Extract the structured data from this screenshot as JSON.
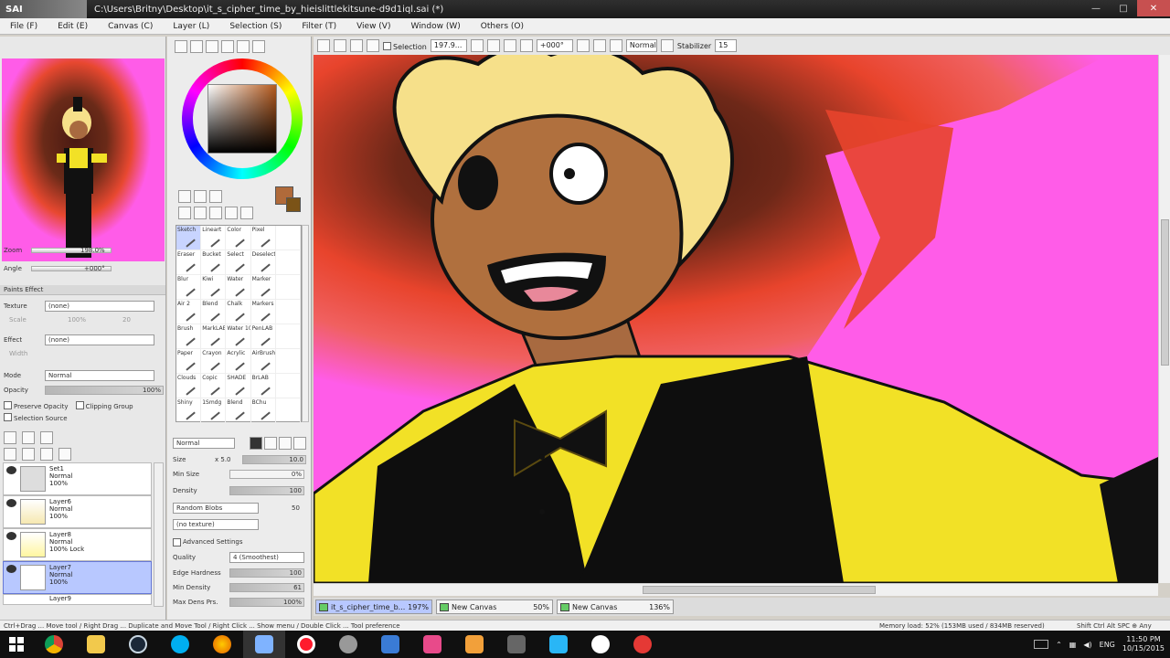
{
  "window": {
    "app_logo": "SAI",
    "title": "C:\\Users\\Britny\\Desktop\\it_s_cipher_time_by_hieislittlekitsune-d9d1iql.sai (*)",
    "min": "—",
    "max": "□",
    "close": "✕"
  },
  "menu": [
    "File (F)",
    "Edit (E)",
    "Canvas (C)",
    "Layer (L)",
    "Selection (S)",
    "Filter (T)",
    "View (V)",
    "Window (W)",
    "Others (O)"
  ],
  "options": {
    "selection_label": "Selection",
    "zoom_value": "197.9...",
    "rotation_value": "+000°",
    "mode_value": "Normal",
    "stabilizer_label": "Stabilizer",
    "stabilizer_value": "15"
  },
  "navigator": {
    "zoom_label": "Zoom",
    "zoom_value": "198.0%",
    "angle_label": "Angle",
    "angle_value": "+000°"
  },
  "paper_effect": {
    "header": "Paints Effect",
    "texture_label": "Texture",
    "texture_value": "(none)",
    "texture_scale_label": "Scale",
    "texture_scale_value": "100%",
    "texture_strength": "20",
    "effect_label": "Effect",
    "effect_value": "(none)",
    "effect_width_label": "Width"
  },
  "layer_props": {
    "mode_label": "Mode",
    "mode_value": "Normal",
    "opacity_label": "Opacity",
    "opacity_value": "100%",
    "preserve_opacity": "Preserve Opacity",
    "clipping_group": "Clipping Group",
    "selection_source": "Selection Source"
  },
  "layers": [
    {
      "name": "Set1",
      "mode": "Normal",
      "opacity": "100%",
      "active": false
    },
    {
      "name": "Layer6",
      "mode": "Normal",
      "opacity": "100%",
      "active": false
    },
    {
      "name": "Layer8",
      "mode": "Normal",
      "opacity": "100% Lock",
      "active": false
    },
    {
      "name": "Layer7",
      "mode": "Normal",
      "opacity": "100%",
      "active": true
    },
    {
      "name": "Layer9",
      "mode": "",
      "opacity": "",
      "active": false
    }
  ],
  "brushes": [
    "Sketch",
    "Lineart",
    "Color",
    "Pixel",
    "",
    "Eraser",
    "Bucket",
    "Select",
    "Deselect",
    "",
    "Blur",
    "Kiwi",
    "Water",
    "Marker",
    "",
    "Air 2",
    "Blend",
    "Chalk",
    "Markers",
    "",
    "Brush",
    "MarkLAB",
    "Water 10",
    "PenLAB",
    "",
    "Paper",
    "Crayon",
    "Acrylic",
    "AirBrush",
    "",
    "Clouds",
    "Copic",
    "SHADE",
    "BrLAB",
    "",
    "Shiny",
    "1Smdg",
    "Blend",
    "BChu",
    ""
  ],
  "tool_props": {
    "mode_value": "Normal",
    "size_label": "Size",
    "size_mult": "x 5.0",
    "size_value": "10.0",
    "min_size_label": "Min Size",
    "min_size_value": "0%",
    "density_label": "Density",
    "density_value": "100",
    "shape_value": "Random Blobs",
    "shape_amount": "50",
    "texture_value": "(no texture)",
    "advanced_label": "Advanced Settings",
    "quality_label": "Quality",
    "quality_value": "4 (Smoothest)",
    "edge_hardness_label": "Edge Hardness",
    "edge_hardness_value": "100",
    "min_density_label": "Min Density",
    "min_density_value": "61",
    "max_dens_label": "Max Dens Prs.",
    "max_dens_value": "100%"
  },
  "tabs": [
    {
      "name": "it_s_cipher_time_b...",
      "zoom": "197%",
      "active": true
    },
    {
      "name": "New Canvas",
      "zoom": "50%",
      "active": false
    },
    {
      "name": "New Canvas",
      "zoom": "136%",
      "active": false
    }
  ],
  "status": {
    "help": "Ctrl+Drag ... Move tool / Right Drag ... Duplicate and Move Tool / Right Click ... Show menu / Double Click ... Tool preference",
    "memory": "Memory load: 52% (153MB used / 834MB reserved)",
    "keys": "Shift Ctrl Alt SPC ⊕ Any"
  },
  "taskbar": {
    "lang": "ENG",
    "time": "11:50 PM",
    "date": "10/15/2015"
  },
  "colors": {
    "primary": "#b06a3a",
    "secondary": "#7b5317",
    "canvas_bg": "#ff5ce8",
    "accent_layer": "#b8c8ff"
  }
}
